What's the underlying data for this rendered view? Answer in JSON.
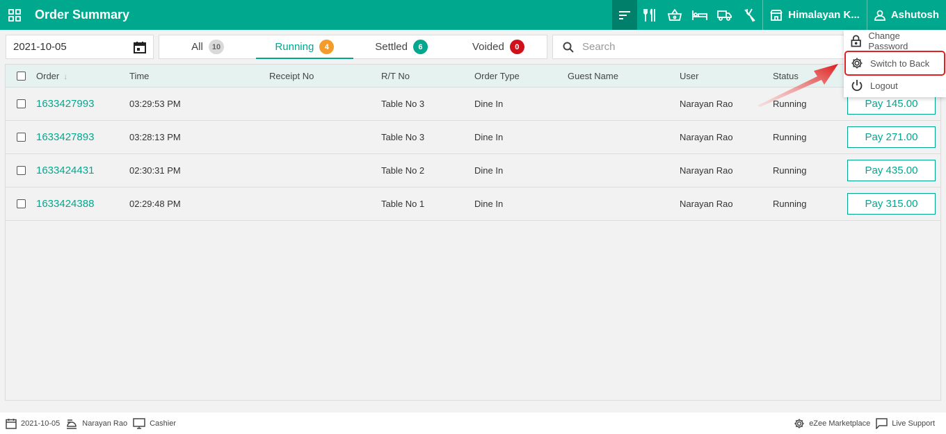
{
  "header": {
    "title": "Order Summary",
    "property_name": "Himalayan K...",
    "user_name": "Ashutosh",
    "icons": [
      "order-summary-icon",
      "restaurant-icon",
      "basket-icon",
      "hotel-bed-icon",
      "delivery-truck-icon",
      "utensils-off-icon"
    ]
  },
  "filters": {
    "date": "2021-10-05",
    "search_placeholder": "Search",
    "tabs": [
      {
        "label": "All",
        "count": "10",
        "color": "#d9d9d9"
      },
      {
        "label": "Running",
        "count": "4",
        "color": "#f39c2b"
      },
      {
        "label": "Settled",
        "count": "6",
        "color": "#00a88e"
      },
      {
        "label": "Voided",
        "count": "0",
        "color": "#d0101b"
      }
    ]
  },
  "table": {
    "columns": [
      "Order",
      "Time",
      "Receipt No",
      "R/T No",
      "Order Type",
      "Guest Name",
      "User",
      "Status"
    ],
    "rows": [
      {
        "order": "1633427993",
        "time": "03:29:53 PM",
        "receipt": "",
        "rt": "Table No 3",
        "type": "Dine In",
        "guest": "",
        "user": "Narayan Rao",
        "status": "Running",
        "action": "Pay 145.00"
      },
      {
        "order": "1633427893",
        "time": "03:28:13 PM",
        "receipt": "",
        "rt": "Table No 3",
        "type": "Dine In",
        "guest": "",
        "user": "Narayan Rao",
        "status": "Running",
        "action": "Pay 271.00"
      },
      {
        "order": "1633424431",
        "time": "02:30:31 PM",
        "receipt": "",
        "rt": "Table No 2",
        "type": "Dine In",
        "guest": "",
        "user": "Narayan Rao",
        "status": "Running",
        "action": "Pay 435.00"
      },
      {
        "order": "1633424388",
        "time": "02:29:48 PM",
        "receipt": "",
        "rt": "Table No 1",
        "type": "Dine In",
        "guest": "",
        "user": "Narayan Rao",
        "status": "Running",
        "action": "Pay 315.00"
      }
    ]
  },
  "user_menu": {
    "items": [
      {
        "label": "Change Password",
        "icon": "lock-icon"
      },
      {
        "label": "Switch to Back",
        "icon": "gear-icon"
      },
      {
        "label": "Logout",
        "icon": "power-icon"
      }
    ]
  },
  "footer": {
    "date": "2021-10-05",
    "user": "Narayan Rao",
    "terminal": "Cashier",
    "marketplace": "eZee Marketplace",
    "support": "Live Support"
  },
  "colors": {
    "brand": "#00a88e",
    "brand_dark": "#00806b",
    "highlight": "#e02020"
  }
}
